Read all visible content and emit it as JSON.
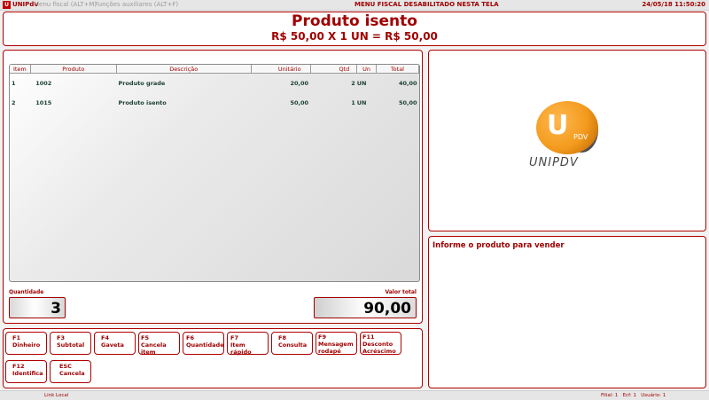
{
  "topbar": {
    "app_name": "UNIPdV",
    "menu_fiscal": "Menu fiscal (ALT+M)",
    "menu_aux": "Funções auxiliares (ALT+F)",
    "notice": "MENU FISCAL DESABILITADO NESTA TELA",
    "clock": "24/05/18 11:50:20"
  },
  "header": {
    "title": "Produto isento",
    "calc": "R$ 50,00  X  1 UN  =  R$ 50,00"
  },
  "table": {
    "columns": [
      "Item",
      "Produto",
      "Descrição",
      "Unitário",
      "Qtd",
      "Un",
      "Total"
    ],
    "rows": [
      [
        "1",
        "1002",
        "Produto  grade",
        "20,00",
        "2",
        "UN",
        "40,00"
      ],
      [
        "2",
        "1015",
        "Produto isento",
        "50,00",
        "1",
        "UN",
        "50,00"
      ]
    ]
  },
  "quantity": {
    "label": "Quantidade",
    "value": "3"
  },
  "total": {
    "label": "Valor total",
    "value": "90,00"
  },
  "function_keys": [
    {
      "key": "F1",
      "label": "Dinheiro"
    },
    {
      "key": "F3",
      "label": "Subtotal"
    },
    {
      "key": "F4",
      "label": "Gaveta"
    },
    {
      "key": "F5",
      "label": "Cancela item"
    },
    {
      "key": "F6",
      "label": "Quantidade"
    },
    {
      "key": "F7",
      "label": "Item rápido"
    },
    {
      "key": "F8",
      "label": "Consulta"
    },
    {
      "key": "F9",
      "label": "Mensagem rodapé"
    },
    {
      "key": "F11",
      "label": "Desconto Acréscimo"
    },
    {
      "key": "F12",
      "label": "Identifica"
    },
    {
      "key": "ESC",
      "label": "Cancela"
    }
  ],
  "logo": {
    "mark": "U",
    "sub": "PDV",
    "word": "UNIPDV"
  },
  "info_message": "Informe o produto para vender",
  "statusbar": {
    "link": "Link Local",
    "filial": "Filial: 1",
    "ecf": "Ecf: 1",
    "usuario": "Usuário: 1"
  }
}
